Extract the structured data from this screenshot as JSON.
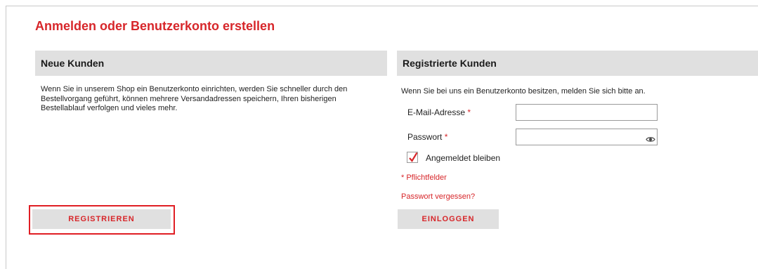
{
  "title": "Anmelden oder Benutzerkonto erstellen",
  "new_customers": {
    "header": "Neue Kunden",
    "description": "Wenn Sie in unserem Shop ein Benutzerkonto einrichten, werden Sie schneller durch den Bestellvorgang geführt, können mehrere Versandadressen speichern, Ihren bisherigen Bestellablauf verfolgen und vieles mehr.",
    "register_button": "REGISTRIEREN"
  },
  "registered_customers": {
    "header": "Registrierte Kunden",
    "description": "Wenn Sie bei uns ein Benutzerkonto besitzen, melden Sie sich bitte an.",
    "email_label": "E-Mail-Adresse",
    "email_value": "",
    "password_label": "Passwort",
    "password_value": "",
    "required_marker": "*",
    "remember_label": "Angemeldet bleiben",
    "remember_checked": true,
    "required_note": "* Pflichtfelder",
    "forgot_link": "Passwort vergessen?",
    "login_button": "EINLOGGEN"
  },
  "icons": {
    "password_toggle": "eye-icon",
    "checkmark": "checkmark-icon"
  },
  "colors": {
    "accent": "#d7262a",
    "header_bg": "#e0e0e0",
    "highlight": "#e01e24"
  }
}
